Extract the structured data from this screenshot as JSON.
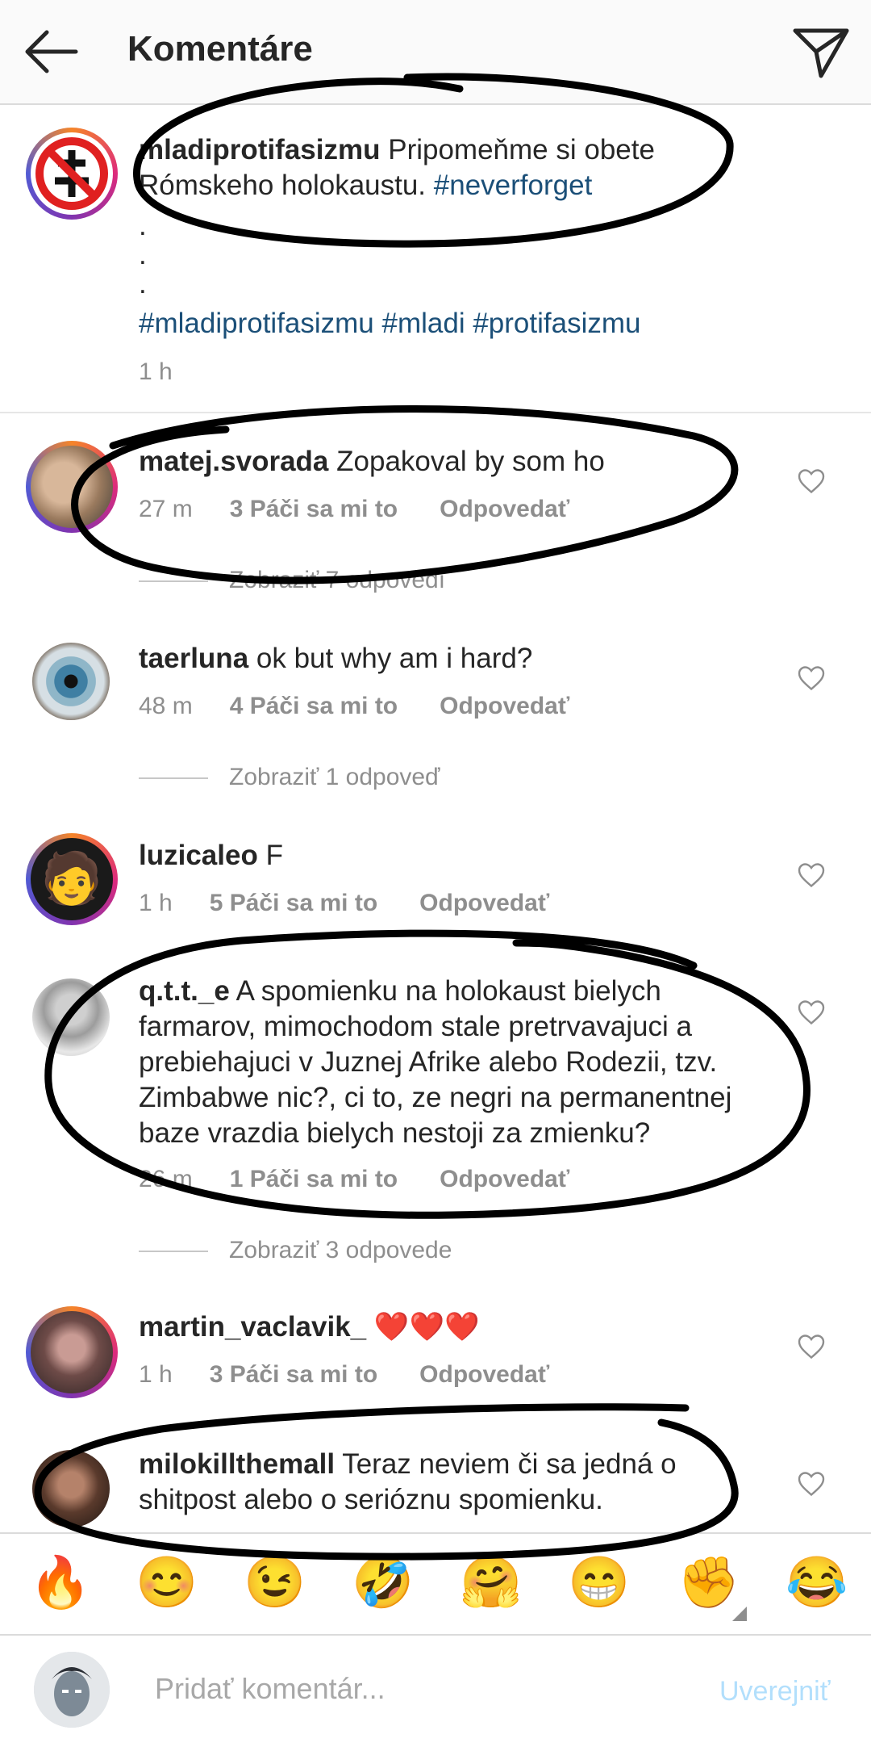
{
  "header": {
    "title": "Komentáre",
    "back_icon": "arrow-left-icon",
    "share_icon": "paper-plane-icon"
  },
  "caption": {
    "username": "mladiprotifasizmu",
    "text": "Pripomeňme si obete Rómskeho holokaustu.",
    "hashtag": "#neverforget",
    "dots": [
      ".",
      ".",
      "."
    ],
    "tags_line": "#mladiprotifasizmu #mladi #protifasizmu",
    "time": "1 h"
  },
  "comments": [
    {
      "username": "matej.svorada",
      "text": "Zopakoval by som ho",
      "time": "27 m",
      "likes": "3 Páči sa mi to",
      "reply": "Odpovedať",
      "view_replies": "Zobraziť 7 odpovedí"
    },
    {
      "username": "taerluna",
      "text": "ok but why am i hard?",
      "time": "48 m",
      "likes": "4 Páči sa mi to",
      "reply": "Odpovedať",
      "view_replies": "Zobraziť 1 odpoveď"
    },
    {
      "username": "luzicaleo",
      "text": "F",
      "time": "1 h",
      "likes": "5 Páči sa mi to",
      "reply": "Odpovedať"
    },
    {
      "username": "q.t.t._e",
      "text": "A spomienku na holokaust bielych farmarov, mimochodom stale pretrvavajuci a prebiehajuci v Juznej Afrike alebo Rodezii, tzv. Zimbabwe nic?, ci to, ze negri na permanentnej baze vrazdia bielych nestoji za zmienku?",
      "time": "26 m",
      "likes": "1 Páči sa mi to",
      "reply": "Odpovedať",
      "view_replies": "Zobraziť 3 odpovede"
    },
    {
      "username": "martin_vaclavik_",
      "text": "❤️❤️❤️",
      "time": "1 h",
      "likes": "3 Páči sa mi to",
      "reply": "Odpovedať"
    },
    {
      "username": "milokillthemall",
      "text": "Teraz neviem či sa jedná o shitpost alebo o serióznu spomienku."
    }
  ],
  "emoji_bar": [
    "🔥",
    "😊",
    "😉",
    "🤣",
    "🤗",
    "😁",
    "✊",
    "😂"
  ],
  "input": {
    "placeholder": "Pridať komentár...",
    "post_label": "Uverejniť"
  },
  "colors": {
    "link": "#1b4f78",
    "muted": "#8e8e8e",
    "post_disabled": "#b2dffc",
    "marker": "#000000"
  }
}
